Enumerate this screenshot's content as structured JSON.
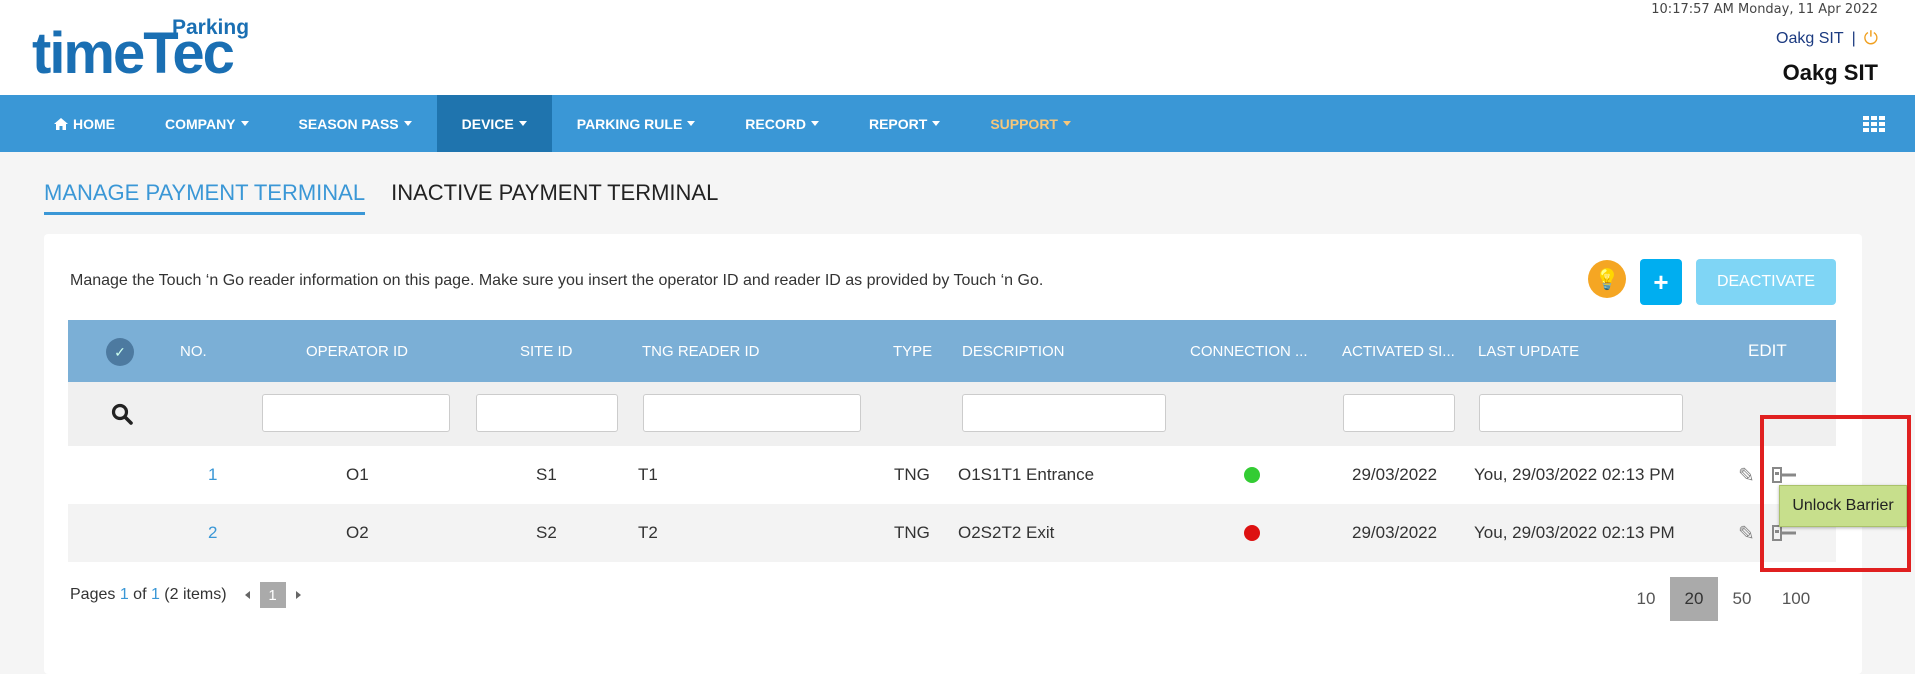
{
  "header": {
    "logo_text": "timeTec",
    "logo_sub": "Parking",
    "datetime": "10:17:57 AM Monday, 11 Apr 2022",
    "user": "Oakg SIT",
    "separator": "|",
    "company": "Oakg SIT"
  },
  "nav": {
    "items": [
      {
        "label": "HOME"
      },
      {
        "label": "COMPANY"
      },
      {
        "label": "SEASON PASS"
      },
      {
        "label": "DEVICE"
      },
      {
        "label": "PARKING RULE"
      },
      {
        "label": "RECORD"
      },
      {
        "label": "REPORT"
      },
      {
        "label": "SUPPORT"
      }
    ]
  },
  "tabs": {
    "manage": "MANAGE PAYMENT TERMINAL",
    "inactive": "INACTIVE PAYMENT TERMINAL"
  },
  "panel": {
    "description": "Manage the Touch ‘n Go reader information on this page. Make sure you insert the operator ID and reader ID as provided by Touch ‘n Go.",
    "add_label": "+",
    "deactivate_label": "DEACTIVATE"
  },
  "table": {
    "headers": [
      "NO.",
      "OPERATOR ID",
      "SITE ID",
      "TNG READER ID",
      "TYPE",
      "DESCRIPTION",
      "CONNECTION ...",
      "ACTIVATED SI...",
      "LAST UPDATE",
      "EDIT"
    ],
    "rows": [
      {
        "no": "1",
        "operator": "O1",
        "site": "S1",
        "reader": "T1",
        "type": "TNG",
        "description": "O1S1T1 Entrance",
        "status_color": "#33cc33",
        "activated": "29/03/2022",
        "last_update": "You, 29/03/2022 02:13 PM"
      },
      {
        "no": "2",
        "operator": "O2",
        "site": "S2",
        "reader": "T2",
        "type": "TNG",
        "description": "O2S2T2 Exit",
        "status_color": "#dd1111",
        "activated": "29/03/2022",
        "last_update": "You, 29/03/2022 02:13 PM"
      }
    ]
  },
  "tooltip": "Unlock Barrier",
  "pager": {
    "summary_prefix": "Pages ",
    "current": "1",
    "summary_mid": " of ",
    "total": "1",
    "summary_suffix": " (2 items)",
    "page_btn": "1",
    "sizes": [
      "10",
      "20",
      "50",
      "100"
    ]
  }
}
